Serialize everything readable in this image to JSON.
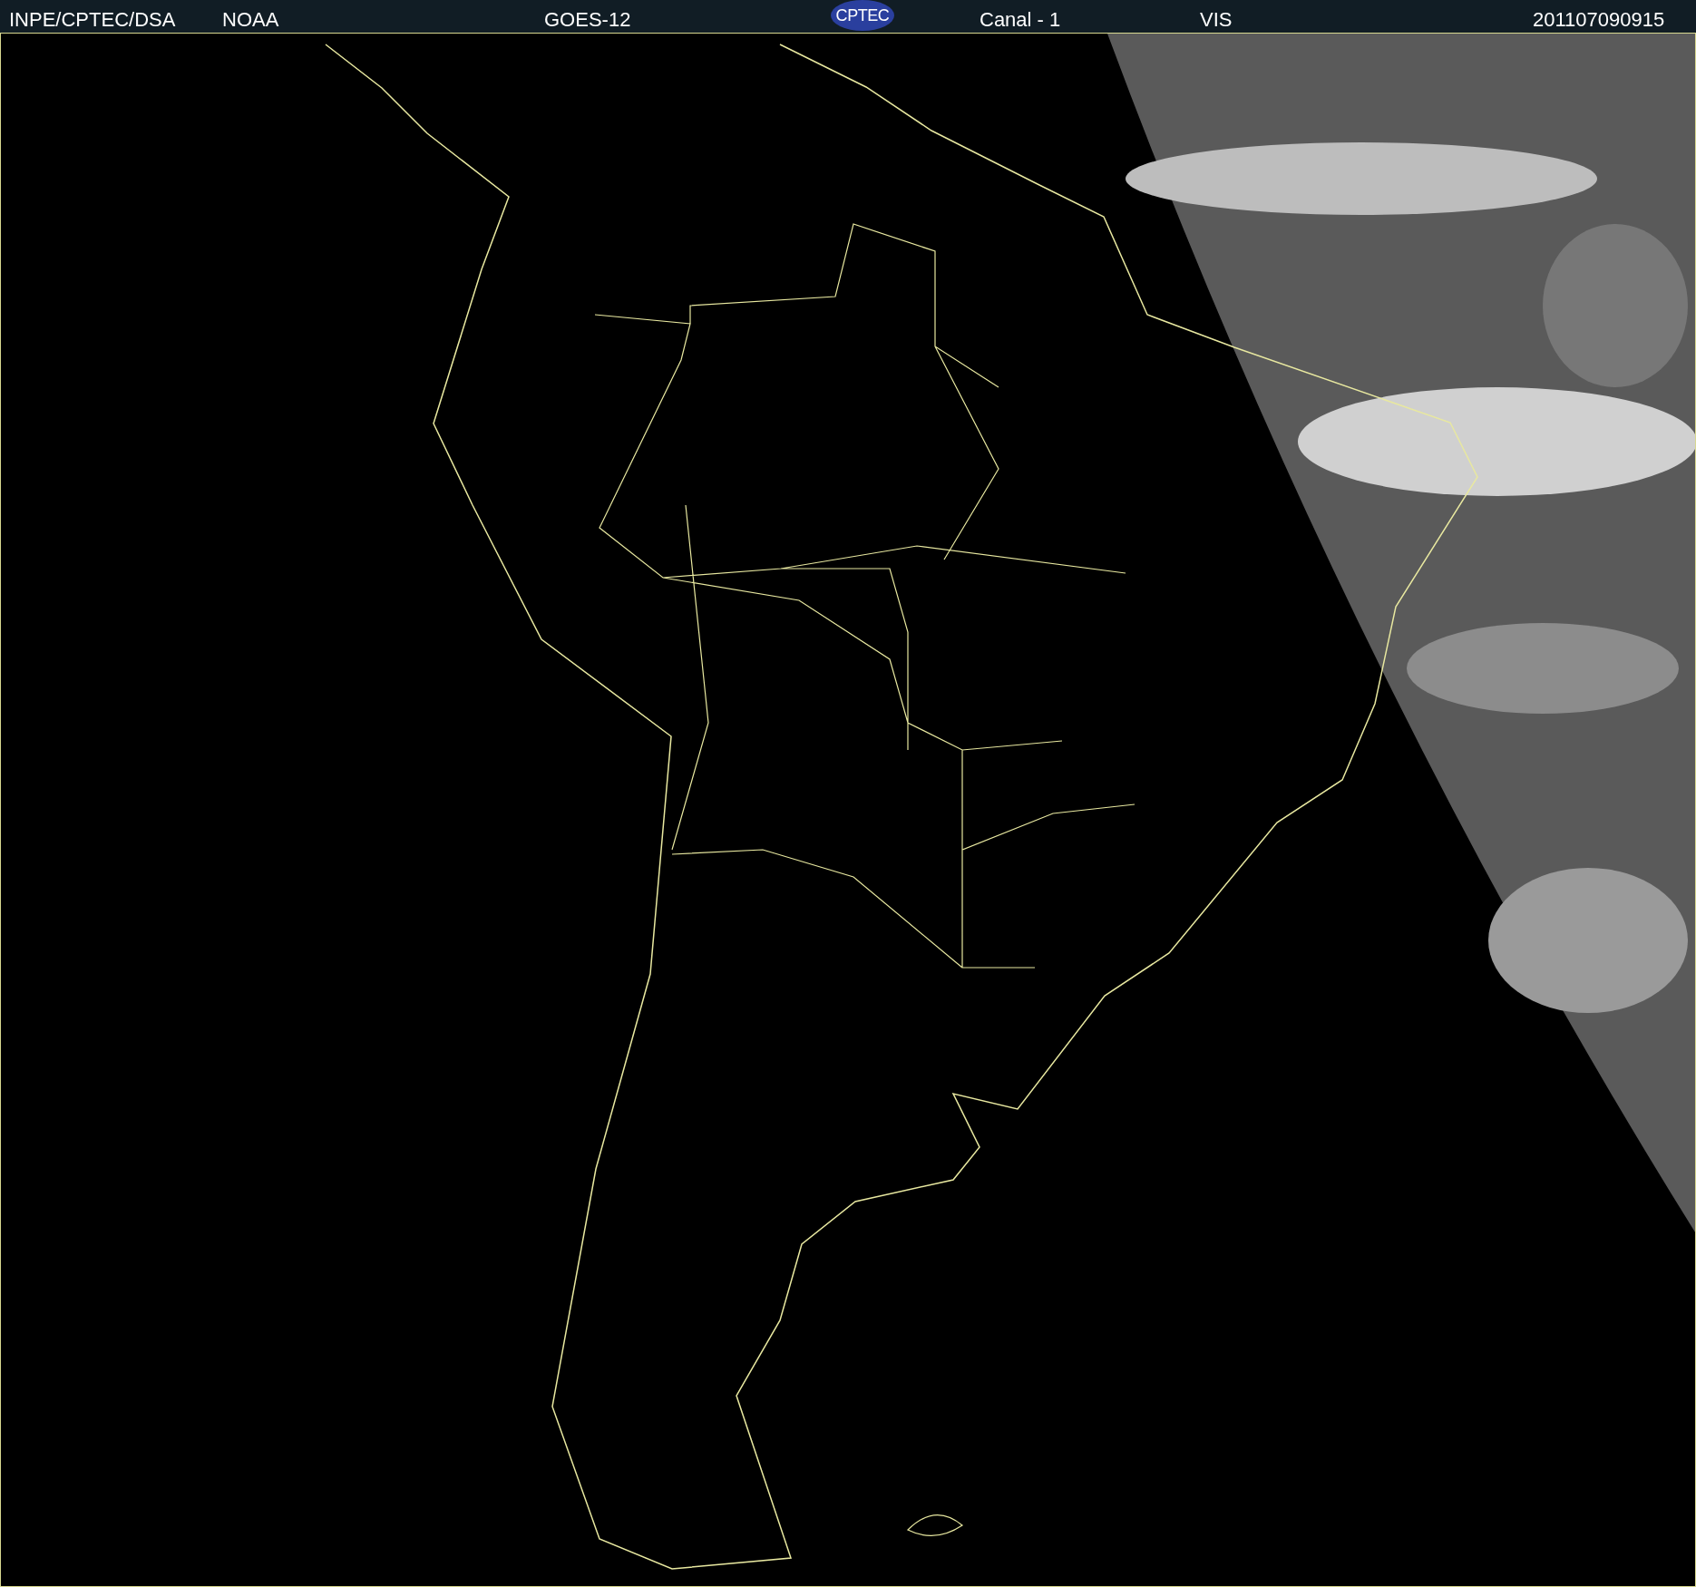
{
  "header": {
    "source": "INPE/CPTEC/DSA",
    "agency": "NOAA",
    "satellite": "GOES-12",
    "logo": "CPTEC",
    "channel": "Canal - 1",
    "band": "VIS",
    "timestamp": "201107090915"
  }
}
